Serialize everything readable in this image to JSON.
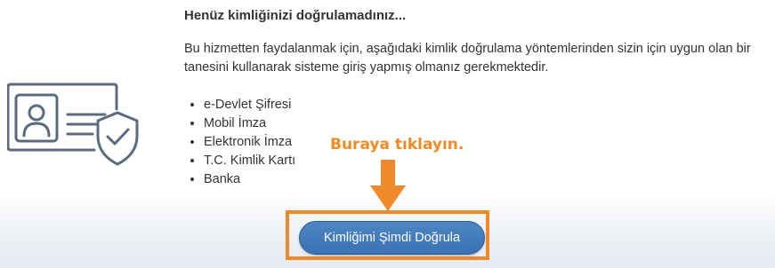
{
  "notice": {
    "heading": "Henüz kimliğinizi doğrulamadınız...",
    "description": "Bu hizmetten faydalanmak için, aşağıdaki kimlik doğrulama yöntemlerinden sizin için uygun olan bir tanesini kullanarak sisteme giriş yapmış olmanız gerekmektedir.",
    "methods": [
      "e-Devlet Şifresi",
      "Mobil İmza",
      "Elektronik İmza",
      "T.C. Kimlik Kartı",
      "Banka"
    ]
  },
  "annotation": {
    "text": "Buraya tıklayın.",
    "color": "#f08a24"
  },
  "actions": {
    "verify_button_label": "Kimliğimi Şimdi Doğrula"
  },
  "icons": {
    "illustration": "id-card-shield-icon",
    "pointer": "down-arrow-icon"
  },
  "colors": {
    "button": "#3f77b7",
    "highlight": "#f0892a",
    "illustration_stroke": "#5a6b7e"
  }
}
